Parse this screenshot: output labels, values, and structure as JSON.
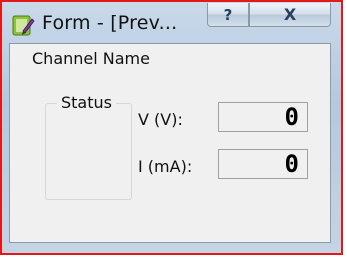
{
  "window": {
    "title": "Form - [Prev...",
    "help_button": "?",
    "close_button": "X",
    "border_color": "#e11919"
  },
  "form": {
    "channel_name": "Channel Name",
    "status_label": "Status",
    "voltage_label": "V (V):",
    "voltage_value": "0",
    "current_label": "I (mA):",
    "current_value": "0"
  },
  "icons": {
    "app_icon": "application-icon"
  }
}
